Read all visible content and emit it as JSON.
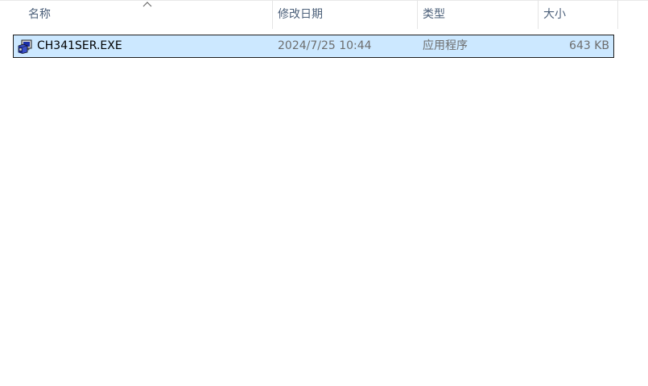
{
  "columns": {
    "name": "名称",
    "date_modified": "修改日期",
    "type": "类型",
    "size": "大小"
  },
  "sort": {
    "column": "name",
    "direction": "ascending",
    "indicator_icon": "chevron-up-icon"
  },
  "files": [
    {
      "name": "CH341SER.EXE",
      "date_modified": "2024/7/25 10:44",
      "type": "应用程序",
      "size": "643 KB",
      "icon": "setup-exe-icon",
      "selected": true
    }
  ],
  "colors": {
    "selection_bg": "#cce8ff",
    "header_text": "#4c607a",
    "secondary_text": "#6d6d6d"
  }
}
